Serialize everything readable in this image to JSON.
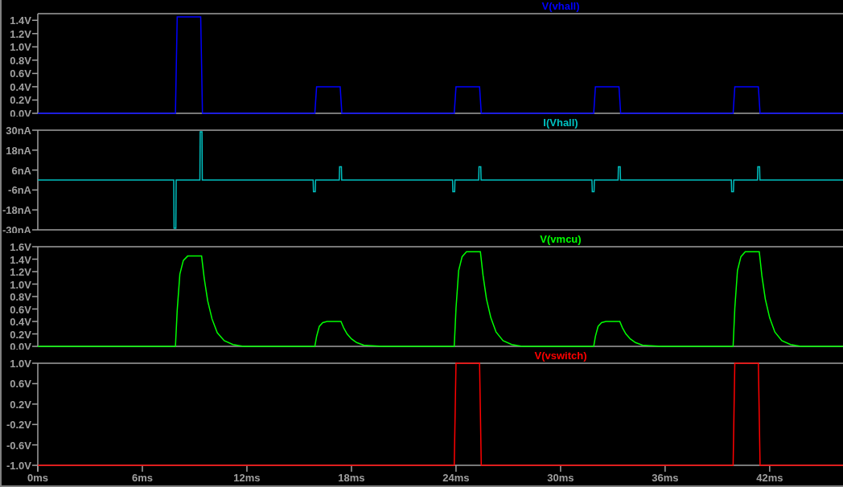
{
  "panes": [
    {
      "chart_data": {
        "type": "line",
        "xlim": [
          0,
          46.3
        ],
        "ylim": [
          0,
          1.5
        ],
        "yticks": [
          {
            "value": 0,
            "label": "0.0V"
          },
          {
            "value": 0.2,
            "label": "0.2V"
          },
          {
            "value": 0.4,
            "label": "0.4V"
          },
          {
            "value": 0.6,
            "label": "0.6V"
          },
          {
            "value": 0.8,
            "label": "0.8V"
          },
          {
            "value": 1.0,
            "label": "1.0V"
          },
          {
            "value": 1.2,
            "label": "1.2V"
          },
          {
            "value": 1.4,
            "label": "1.4V"
          }
        ],
        "x": [
          0,
          7.9,
          8.0,
          9.35,
          9.45,
          15.9,
          16.0,
          17.35,
          17.45,
          23.9,
          24.0,
          25.35,
          25.45,
          31.9,
          32.0,
          33.35,
          33.45,
          39.9,
          40.0,
          41.35,
          41.45,
          46.3
        ],
        "series": [
          {
            "name": "V(vhall)",
            "color": "#0000ff",
            "values": [
              0,
              0,
              1.45,
              1.45,
              0,
              0,
              0.4,
              0.4,
              0,
              0,
              0.4,
              0.4,
              0,
              0,
              0.4,
              0.4,
              0,
              0,
              0.4,
              0.4,
              0,
              0
            ]
          }
        ]
      }
    },
    {
      "chart_data": {
        "type": "line",
        "xlim": [
          0,
          46.3
        ],
        "ylim": [
          -30,
          30
        ],
        "yticks": [
          {
            "value": -30,
            "label": "-30nA"
          },
          {
            "value": -18,
            "label": "-18nA"
          },
          {
            "value": -6,
            "label": "-6nA"
          },
          {
            "value": 6,
            "label": "6nA"
          },
          {
            "value": 18,
            "label": "18nA"
          },
          {
            "value": 30,
            "label": "30nA"
          }
        ],
        "x": [
          0,
          7.8,
          7.82,
          7.92,
          7.94,
          9.3,
          9.32,
          9.42,
          9.44,
          15.8,
          15.82,
          15.92,
          15.94,
          17.3,
          17.32,
          17.42,
          17.44,
          23.8,
          23.82,
          23.92,
          23.94,
          25.3,
          25.32,
          25.42,
          25.44,
          31.8,
          31.82,
          31.92,
          31.94,
          33.3,
          33.32,
          33.42,
          33.44,
          39.8,
          39.82,
          39.92,
          39.94,
          41.3,
          41.32,
          41.42,
          41.44,
          46.3
        ],
        "series": [
          {
            "name": "I(Vhall)",
            "color": "#00c0c0",
            "values": [
              0,
              0,
              -29,
              -29,
              0,
              0,
              29,
              29,
              0,
              0,
              -7,
              -7,
              0,
              0,
              8,
              8,
              0,
              0,
              -7,
              -7,
              0,
              0,
              8,
              8,
              0,
              0,
              -7,
              -7,
              0,
              0,
              8,
              8,
              0,
              0,
              -7,
              -7,
              0,
              0,
              8,
              8,
              0,
              0
            ]
          }
        ]
      }
    },
    {
      "chart_data": {
        "type": "line",
        "xlim": [
          0,
          46.3
        ],
        "ylim": [
          0,
          1.6
        ],
        "yticks": [
          {
            "value": 0,
            "label": "0.0V"
          },
          {
            "value": 0.2,
            "label": "0.2V"
          },
          {
            "value": 0.4,
            "label": "0.4V"
          },
          {
            "value": 0.6,
            "label": "0.6V"
          },
          {
            "value": 0.8,
            "label": "0.8V"
          },
          {
            "value": 1.0,
            "label": "1.0V"
          },
          {
            "value": 1.2,
            "label": "1.2V"
          },
          {
            "value": 1.4,
            "label": "1.4V"
          },
          {
            "value": 1.6,
            "label": "1.6V"
          }
        ],
        "x": [
          0,
          7.9,
          8.0,
          8.15,
          8.35,
          8.6,
          9.4,
          9.55,
          9.75,
          10.0,
          10.3,
          10.7,
          11.2,
          11.8,
          15.9,
          16.0,
          16.15,
          16.35,
          16.6,
          17.4,
          17.55,
          17.75,
          18.0,
          18.3,
          18.7,
          19.2,
          19.8,
          23.9,
          24.0,
          24.15,
          24.35,
          24.6,
          25.4,
          25.55,
          25.75,
          26.0,
          26.3,
          26.7,
          27.2,
          27.8,
          31.9,
          32.0,
          32.15,
          32.35,
          32.6,
          33.4,
          33.55,
          33.75,
          34.0,
          34.3,
          34.7,
          35.2,
          35.8,
          39.9,
          40.0,
          40.15,
          40.35,
          40.6,
          41.4,
          41.55,
          41.75,
          42.0,
          42.3,
          42.7,
          43.2,
          43.8,
          46.3
        ],
        "series": [
          {
            "name": "V(vmcu)",
            "color": "#00ff00",
            "values": [
              0,
              0,
              0.58,
              1.16,
              1.38,
              1.45,
              1.45,
              1.09,
              0.73,
              0.44,
              0.22,
              0.09,
              0.03,
              0,
              0,
              0.16,
              0.32,
              0.38,
              0.4,
              0.4,
              0.3,
              0.2,
              0.12,
              0.06,
              0.02,
              0.01,
              0,
              0,
              0.61,
              1.22,
              1.44,
              1.52,
              1.52,
              1.14,
              0.76,
              0.46,
              0.23,
              0.09,
              0.03,
              0,
              0,
              0.16,
              0.32,
              0.38,
              0.4,
              0.4,
              0.3,
              0.2,
              0.12,
              0.06,
              0.02,
              0.01,
              0,
              0,
              0.61,
              1.22,
              1.44,
              1.52,
              1.52,
              1.14,
              0.76,
              0.46,
              0.23,
              0.09,
              0.03,
              0,
              0
            ]
          }
        ]
      }
    },
    {
      "chart_data": {
        "type": "line",
        "xlim": [
          0,
          46.3
        ],
        "ylim": [
          -1,
          1
        ],
        "yticks": [
          {
            "value": -1,
            "label": "-1.0V"
          },
          {
            "value": -0.6,
            "label": "-0.6V"
          },
          {
            "value": -0.2,
            "label": "-0.2V"
          },
          {
            "value": 0.2,
            "label": "0.2V"
          },
          {
            "value": 0.6,
            "label": "0.6V"
          },
          {
            "value": 1,
            "label": "1.0V"
          }
        ],
        "xticks": [
          {
            "value": 0,
            "label": "0ms"
          },
          {
            "value": 6,
            "label": "6ms"
          },
          {
            "value": 12,
            "label": "12ms"
          },
          {
            "value": 18,
            "label": "18ms"
          },
          {
            "value": 24,
            "label": "24ms"
          },
          {
            "value": 30,
            "label": "30ms"
          },
          {
            "value": 36,
            "label": "36ms"
          },
          {
            "value": 42,
            "label": "42ms"
          }
        ],
        "x": [
          0,
          23.9,
          24.0,
          25.35,
          25.45,
          39.9,
          40.0,
          41.35,
          41.45,
          46.3
        ],
        "series": [
          {
            "name": "V(vswitch)",
            "color": "#ff0000",
            "values": [
              -1,
              -1,
              1,
              1,
              -1,
              -1,
              1,
              1,
              -1,
              -1
            ]
          }
        ]
      }
    }
  ]
}
